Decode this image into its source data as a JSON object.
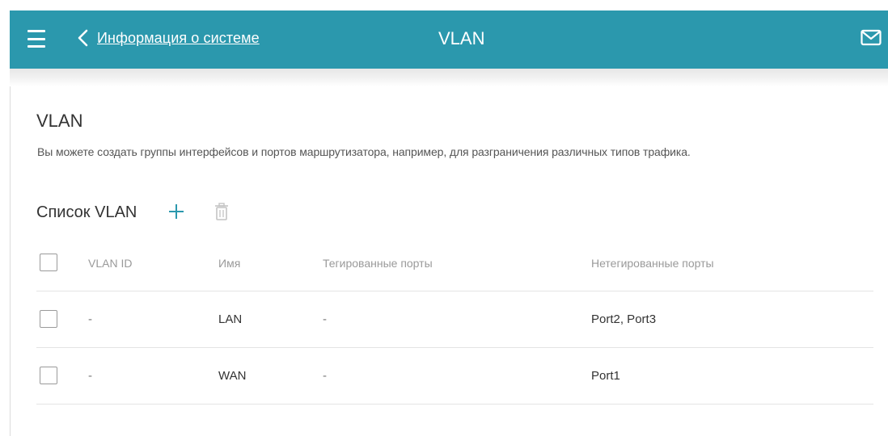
{
  "header": {
    "back_label": "Информация о системе",
    "title": "VLAN",
    "accent_color": "#2b98ad"
  },
  "page": {
    "title": "VLAN",
    "description": "Вы можете создать группы интерфейсов и портов маршрутизатора, например, для разграничения различных типов трафика."
  },
  "vlan_list": {
    "heading": "Список VLAN",
    "columns": [
      "VLAN ID",
      "Имя",
      "Тегированные порты",
      "Нетегированные порты"
    ],
    "rows": [
      {
        "vlan_id": "-",
        "name": "LAN",
        "tagged": "-",
        "untagged": "Port2, Port3"
      },
      {
        "vlan_id": "-",
        "name": "WAN",
        "tagged": "-",
        "untagged": "Port1"
      }
    ]
  },
  "icons": {
    "menu": "hamburger-menu-icon",
    "back": "chevron-left-icon",
    "notifications": "mail-icon",
    "add": "plus-icon",
    "delete": "trash-icon"
  }
}
